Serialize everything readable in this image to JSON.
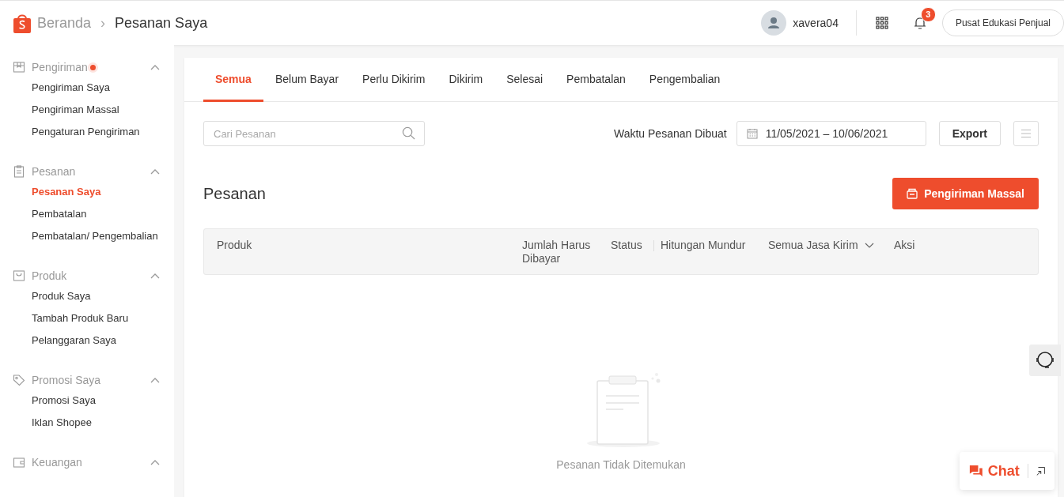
{
  "header": {
    "breadcrumb_home": "Beranda",
    "breadcrumb_separator": "›",
    "page_title": "Pesanan Saya",
    "username": "xavera04",
    "notification_count": "3",
    "help_button": "Pusat Edukasi Penjual"
  },
  "sidebar": {
    "groups": [
      {
        "title": "Pengiriman",
        "dot": true,
        "expanded": true,
        "items": [
          {
            "label": "Pengiriman Saya",
            "selected": false
          },
          {
            "label": "Pengiriman Massal",
            "selected": false
          },
          {
            "label": "Pengaturan Pengiriman",
            "selected": false
          }
        ]
      },
      {
        "title": "Pesanan",
        "expanded": true,
        "items": [
          {
            "label": "Pesanan Saya",
            "selected": true
          },
          {
            "label": "Pembatalan",
            "selected": false
          },
          {
            "label": "Pembatalan/ Pengembalian",
            "selected": false
          }
        ]
      },
      {
        "title": "Produk",
        "expanded": true,
        "items": [
          {
            "label": "Produk Saya",
            "selected": false
          },
          {
            "label": "Tambah Produk Baru",
            "selected": false
          },
          {
            "label": "Pelanggaran Saya",
            "selected": false
          }
        ]
      },
      {
        "title": "Promosi Saya",
        "expanded": true,
        "items": [
          {
            "label": "Promosi Saya",
            "selected": false
          },
          {
            "label": "Iklan Shopee",
            "selected": false
          }
        ]
      },
      {
        "title": "Keuangan",
        "expanded": true
      }
    ]
  },
  "tabs": [
    {
      "label": "Semua",
      "selected": true
    },
    {
      "label": "Belum Bayar",
      "selected": false
    },
    {
      "label": "Perlu Dikirim",
      "selected": false
    },
    {
      "label": "Dikirim",
      "selected": false
    },
    {
      "label": "Selesai",
      "selected": false
    },
    {
      "label": "Pembatalan",
      "selected": false
    },
    {
      "label": "Pengembalian",
      "selected": false
    }
  ],
  "filters": {
    "search_placeholder": "Cari Pesanan",
    "date_label": "Waktu Pesanan Dibuat",
    "date_range": "11/05/2021 – 10/06/2021",
    "export_button": "Export"
  },
  "orders": {
    "title": "Pesanan",
    "bulk_button": "Pengiriman Massal",
    "columns": [
      {
        "label": "Produk",
        "kind": "plain"
      },
      {
        "label": "Jumlah Harus Dibayar",
        "kind": "plain"
      },
      {
        "label": "Status",
        "kind": "plain"
      },
      {
        "label": "Hitungan Mundur",
        "kind": "divided"
      },
      {
        "label": "Semua Jasa Kirim",
        "kind": "dropdown"
      },
      {
        "label": "Aksi",
        "kind": "plain"
      }
    ],
    "empty_message": "Pesanan Tidak Ditemukan"
  },
  "chat": {
    "label": "Chat"
  }
}
